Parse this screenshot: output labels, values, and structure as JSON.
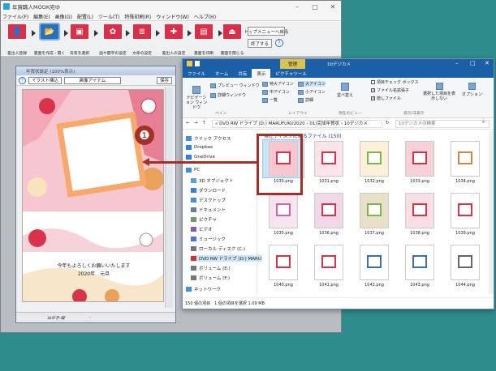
{
  "app": {
    "title": "年賀職人MOOK宛ゆ",
    "menu": [
      "ファイル(F)",
      "編集(E)",
      "画像(G)",
      "配置(L)",
      "ツール(T)",
      "特殊印刷(R)",
      "ウィンドウ(W)",
      "ヘルプ(H)"
    ],
    "steps": [
      {
        "label": "差出人登録",
        "icon": "person-icon"
      },
      {
        "label": "裏面を作成・開く",
        "icon": "folder-icon"
      },
      {
        "label": "背景を選択",
        "icon": "image-icon"
      },
      {
        "label": "画や題字の設定",
        "icon": "illustration-icon"
      },
      {
        "label": "文章の設定",
        "icon": "text-icon"
      },
      {
        "label": "差出人の設定",
        "icon": "sender-icon"
      },
      {
        "label": "裏面を印刷",
        "icon": "print-icon"
      },
      {
        "label": "裏面を閉じる",
        "icon": "close-doc-icon"
      }
    ],
    "top_menu_button": "トップメニューへ戻る",
    "exit_button": "終了する",
    "help_glyph": "?"
  },
  "card": {
    "title": "年賀状設定 (100%表示)",
    "toolbar": {
      "tool1": "イラスト挿込",
      "tool2": "画像アイテム",
      "save": "保存"
    },
    "greeting_line1": "今年もよろしくお願いいたします",
    "greeting_line2": "2020年　元旦",
    "status_left": "はがき-縦"
  },
  "explorer": {
    "context_tab": "管理",
    "window_title": "10デジカメ",
    "tabs": [
      "ファイル",
      "ホーム",
      "共有",
      "表示",
      "ピクチャツール"
    ],
    "active_tab": "表示",
    "ribbon": {
      "pane": {
        "preview": "プレビュー ウィンドウ",
        "details": "詳細ウィンドウ",
        "nav": "ナビゲーション ウィンドウ",
        "group": "ペイン"
      },
      "layout": {
        "xl": "特大アイコン",
        "large": "大アイコン",
        "medium": "中アイコン",
        "small": "小アイコン",
        "list": "一覧",
        "detail": "詳細",
        "group": "レイアウト"
      },
      "view": {
        "sort": "並べ替え",
        "group": "現在のビュー"
      },
      "show": {
        "item_check": "項目チェック ボックス",
        "ext": "ファイル名拡張子",
        "hidden": "隠しファイル",
        "hide_sel": "選択した項目を表示しない",
        "group": "表示/非表示"
      },
      "options": "オプション"
    },
    "address_path": "«  DVD RW ドライブ (D:) MARUFUKU2020  ›  01)完成年賀状  ›  10デジカメ",
    "search_placeholder": "10デジカメの検索",
    "nav": [
      "クイック アクセス",
      "Dropbox",
      "OneDrive",
      "PC",
      "3D オブジェクト",
      "ダウンロード",
      "デスクトップ",
      "ドキュメント",
      "ピクチャ",
      "ビデオ",
      "ミュージック",
      "ローカル ディスク (C:)",
      "DVD RW ドライブ (D:) MARU",
      "ボリューム (E:)",
      "ボリューム (F:)",
      "ネットワーク"
    ],
    "section_header": "現在ディスクにあるファイル (150)",
    "files": [
      "1030.png",
      "1031.png",
      "1032.png",
      "1033.png",
      "1034.png",
      "1035.png",
      "1036.png",
      "1037.png",
      "1038.png",
      "1039.png",
      "1040.png",
      "1041.png",
      "1042.png",
      "1043.png",
      "1044.png"
    ],
    "selected_file": "1030.png",
    "status": "150 個の項目　1 個の項目を選択  1.09 MB"
  },
  "callout": {
    "number": "❶"
  },
  "colors": {
    "accent": "#a33028",
    "step_red": "#d9304a",
    "step_active": "#2b6fb9",
    "desktop": "#2e8c8c"
  }
}
